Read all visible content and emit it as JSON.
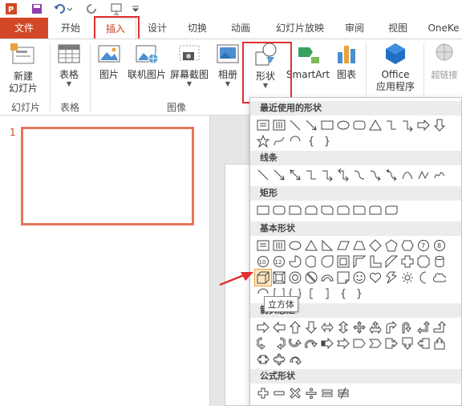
{
  "tabs": [
    "文件",
    "开始",
    "插入",
    "设计",
    "切换",
    "动画",
    "幻灯片放映",
    "审阅",
    "视图",
    "OneKe"
  ],
  "ribbon": {
    "new_slide": [
      "新建",
      "幻灯片"
    ],
    "table": "表格",
    "picture": "图片",
    "online_picture": "联机图片",
    "screenshot": "屏幕截图",
    "album": "相册",
    "shapes": "形状",
    "smartart": "SmartArt",
    "chart": "图表",
    "office_apps": [
      "Office",
      "应用程序"
    ],
    "hyperlink": "超链接",
    "groups": [
      "幻灯片",
      "表格",
      "图像"
    ]
  },
  "slides": {
    "number": "1"
  },
  "gallery": {
    "sections": [
      "最近使用的形状",
      "线条",
      "矩形",
      "基本形状",
      "箭头总汇",
      "公式形状"
    ],
    "brace_open": "{",
    "brace_close": "}",
    "tooltip": "立方体"
  },
  "colors": {
    "accent": "#d24726",
    "highlight_box": "#e03030"
  }
}
